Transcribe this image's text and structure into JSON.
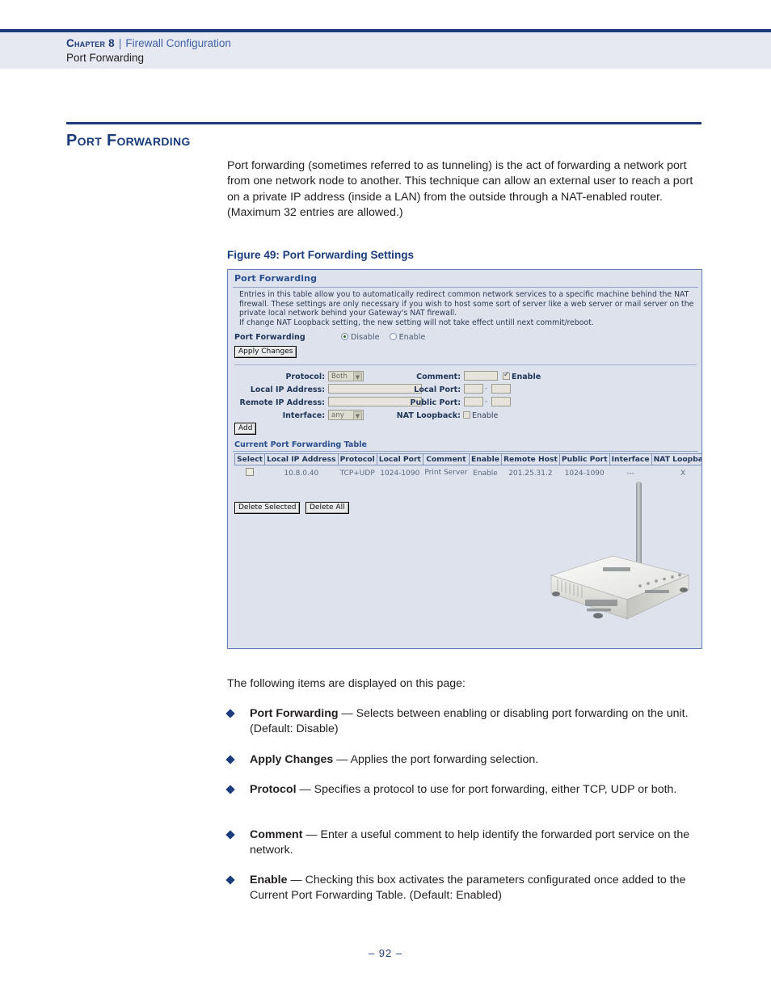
{
  "header": {
    "chapter_label": "Chapter 8",
    "separator": "|",
    "section_label": "Firewall Configuration",
    "subsection_label": "Port Forwarding"
  },
  "section": {
    "title": "Port Forwarding"
  },
  "intro_paragraph": "Port forwarding (sometimes referred to as tunneling) is the act of forwarding a network port from one network node to another. This technique can allow an external user to reach a port on a private IP address (inside a LAN) from the outside through a NAT-enabled router. (Maximum 32 entries are allowed.)",
  "figure": {
    "caption": "Figure 49:  Port Forwarding Settings",
    "panel_title": "Port Forwarding",
    "description": "Entries in this table allow you to automatically redirect common network services to a specific machine behind the NAT firewall. These settings are only necessary if you wish to host some sort of server like a web server or mail server on the private local network behind your Gateway's NAT firewall.\nIf change NAT Loopback setting, the new setting will not take effect untill next commit/reboot.",
    "port_forwarding_label": "Port Forwarding",
    "radio_disable": "Disable",
    "radio_enable": "Enable",
    "radio_selected": "Disable",
    "apply_changes_button": "Apply Changes",
    "form": {
      "protocol_label": "Protocol:",
      "protocol_value": "Both",
      "comment_label": "Comment:",
      "comment_value": "",
      "comment_enable_label": "Enable",
      "comment_enable_checked": true,
      "local_ip_label": "Local IP Address:",
      "local_ip_value": "",
      "local_port_label": "Local Port:",
      "local_port_from": "",
      "local_port_to": "",
      "remote_ip_label": "Remote IP Address:",
      "remote_ip_value": "",
      "public_port_label": "Public Port:",
      "public_port_from": "",
      "public_port_to": "",
      "interface_label": "Interface:",
      "interface_value": "any",
      "nat_loopback_label": "NAT Loopback:",
      "nat_loopback_enable_label": "Enable",
      "nat_loopback_checked": false,
      "range_separator": "-",
      "add_button": "Add"
    },
    "table": {
      "title": "Current Port Forwarding Table",
      "columns": [
        "Select",
        "Local IP Address",
        "Protocol",
        "Local Port",
        "Comment",
        "Enable",
        "Remote Host",
        "Public Port",
        "Interface",
        "NAT Loopback"
      ],
      "rows": [
        {
          "select": "",
          "local_ip_address": "10.8.0.40",
          "protocol": "TCP+UDP",
          "local_port": "1024-1090",
          "comment": "Print Server",
          "enable": "Enable",
          "remote_host": "201.25.31.2",
          "public_port": "1024-1090",
          "interface": "---",
          "nat_loopback": "X"
        }
      ],
      "delete_selected_button": "Delete Selected",
      "delete_all_button": "Delete All"
    }
  },
  "following_items_intro": "The following items are displayed on this page:",
  "bullets": [
    {
      "term": "Port Forwarding",
      "dash": "—",
      "description": "Selects between enabling or disabling port forwarding on the unit. (Default: Disable)"
    },
    {
      "term": "Apply Changes",
      "dash": "—",
      "description": "Applies the port forwarding selection."
    },
    {
      "term": "Protocol",
      "dash": "—",
      "description": "Specifies a protocol to use for port forwarding, either TCP, UDP or both."
    },
    {
      "term": "Comment",
      "dash": "—",
      "description": "Enter a useful comment to help identify the forwarded port service on the network."
    },
    {
      "term": "Enable",
      "dash": "—",
      "description": "Checking this box activates the parameters configurated once added to the Current Port Forwarding Table. (Default: Enabled)"
    }
  ],
  "footer": {
    "page_number": "–  92  –"
  },
  "colors": {
    "accent_navy": "#1b3c7a",
    "header_band": "#e6e9f2",
    "figure_bg": "#dde2ed",
    "figure_border": "#5d7bb5"
  }
}
